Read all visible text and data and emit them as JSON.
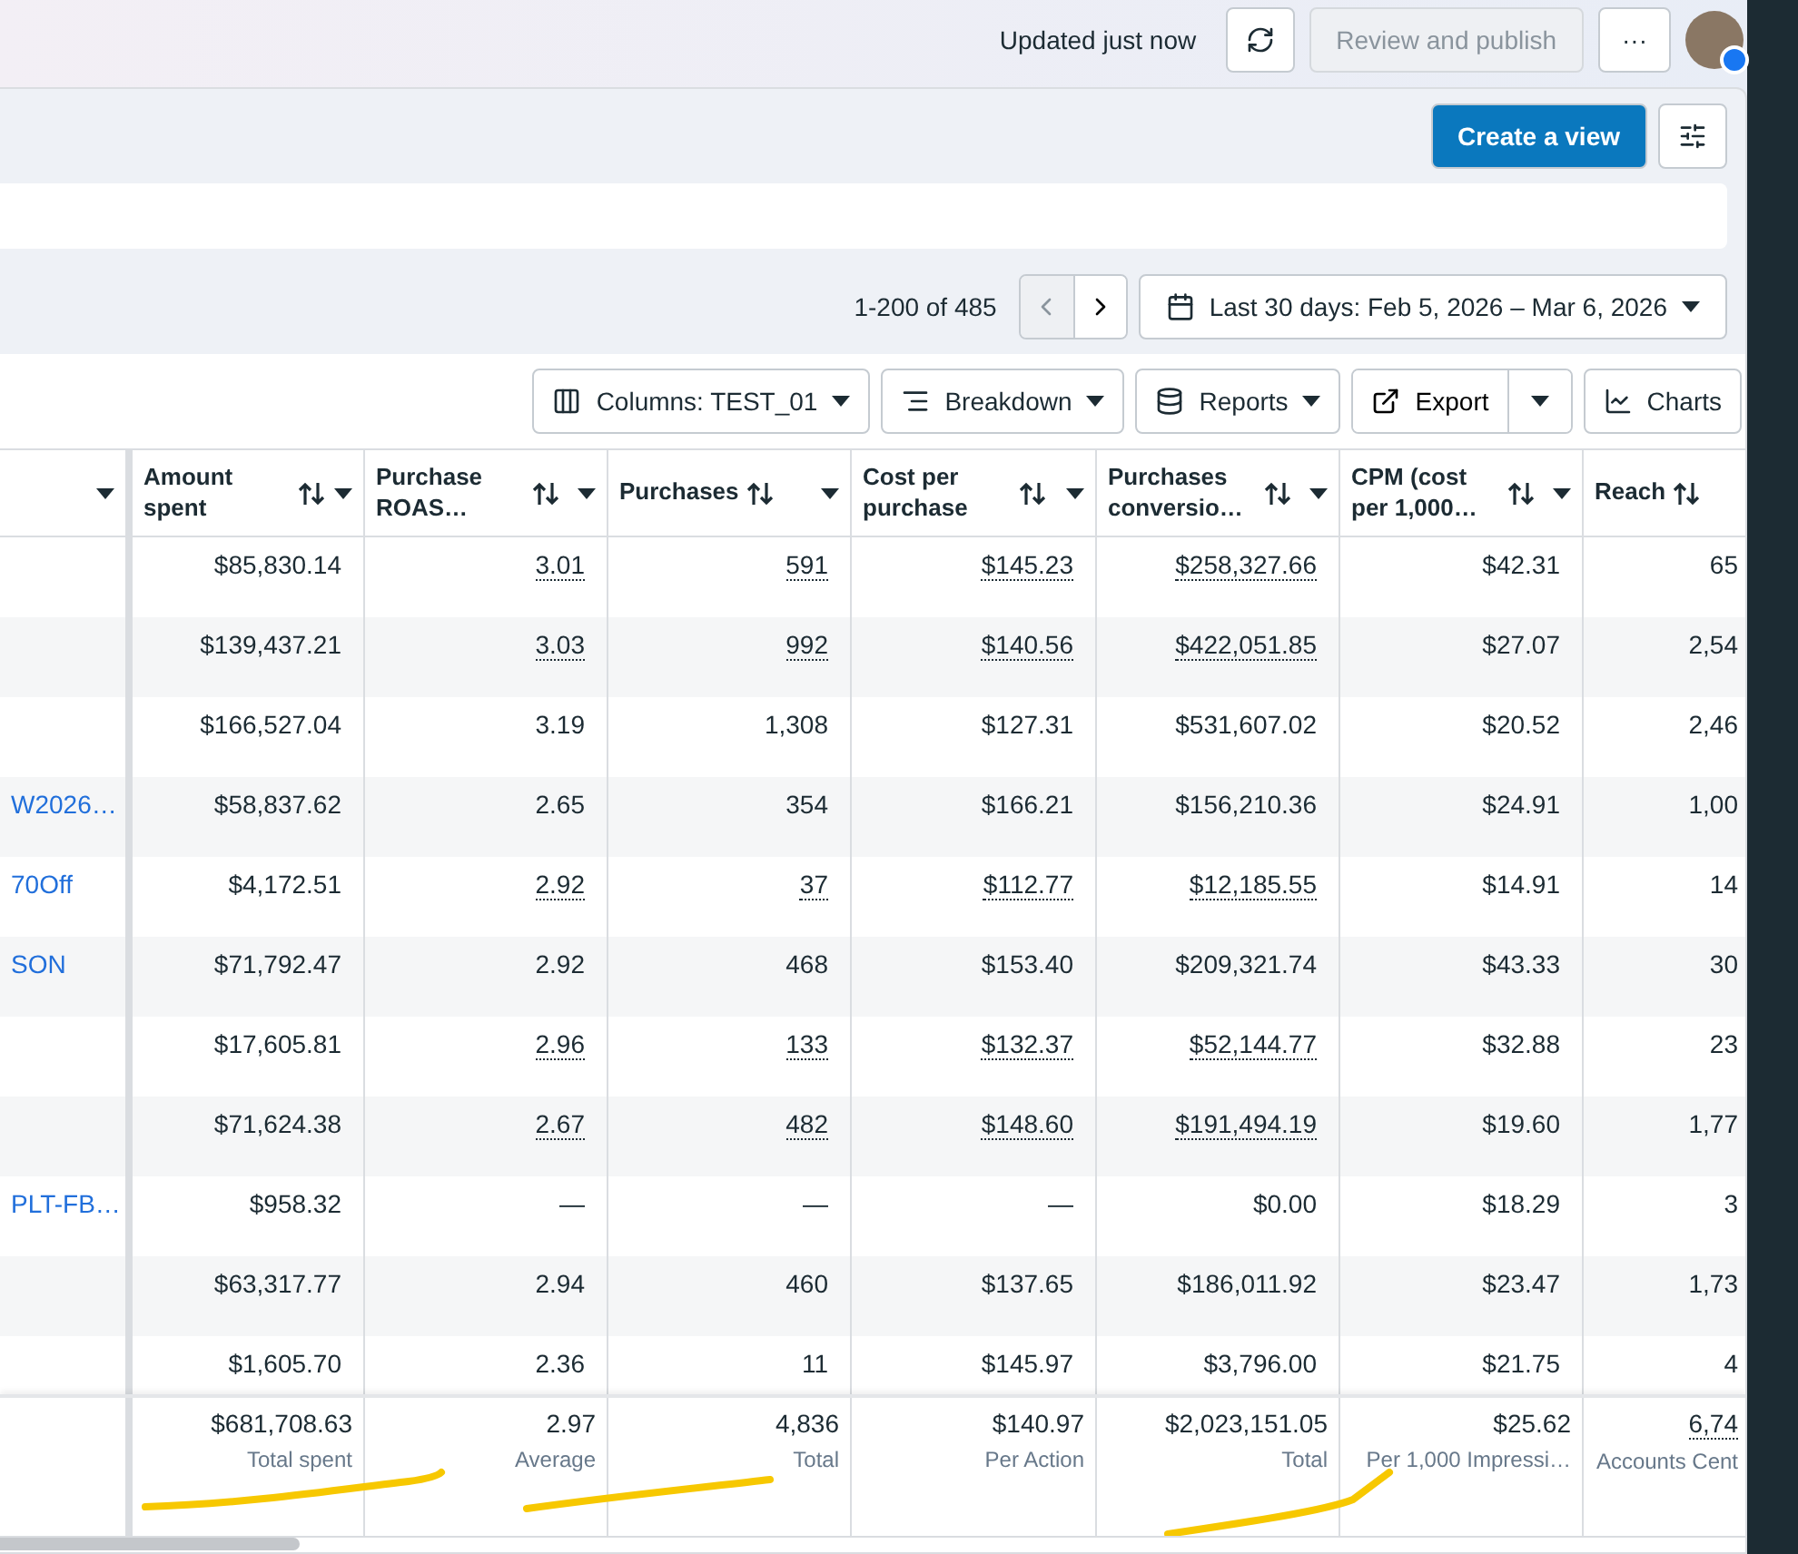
{
  "top_bar": {
    "status": "Updated just now",
    "review_button": {
      "label": "Review and publish",
      "disabled": true
    },
    "more_button": "···"
  },
  "view_bar": {
    "create_button": "Create a view"
  },
  "pagination": {
    "range": "1-200 of 485",
    "date_range": "Last 30 days: Feb 5, 2026 – Mar 6, 2026"
  },
  "toolbar": [
    {
      "kind": "columns",
      "label": "Columns: TEST_01"
    },
    {
      "kind": "breakdown",
      "label": "Breakdown"
    },
    {
      "kind": "reports",
      "label": "Reports"
    },
    {
      "kind": "export",
      "label": "Export"
    },
    {
      "kind": "charts",
      "label": "Charts"
    }
  ],
  "table": {
    "columns": [
      {
        "sortable": false,
        "menu": true
      },
      {
        "label": "Amount spent",
        "sortable": true,
        "menu": true
      },
      {
        "label": "Purchase ROAS…",
        "sortable": true,
        "menu": true
      },
      {
        "label": "Purchases",
        "sortable": true,
        "menu": true
      },
      {
        "label": "Cost per purchase",
        "sortable": true,
        "menu": true
      },
      {
        "label": "Purchases conversio…",
        "sortable": true,
        "menu": true
      },
      {
        "label": "CPM (cost per 1,000…",
        "sortable": true,
        "menu": true
      },
      {
        "label": "Reach",
        "sortable": true,
        "menu": false
      }
    ],
    "rows": [
      {
        "name": "",
        "cells": [
          {
            "text": "$85,830.14",
            "dotted": false
          },
          {
            "text": "3.01",
            "dotted": true
          },
          {
            "text": "591",
            "dotted": true
          },
          {
            "text": "$145.23",
            "dotted": true
          },
          {
            "text": "$258,327.66",
            "dotted": true
          },
          {
            "text": "$42.31",
            "dotted": false
          },
          {
            "text": "65",
            "dotted": false
          }
        ]
      },
      {
        "name": "",
        "cells": [
          {
            "text": "$139,437.21",
            "dotted": false
          },
          {
            "text": "3.03",
            "dotted": true
          },
          {
            "text": "992",
            "dotted": true
          },
          {
            "text": "$140.56",
            "dotted": true
          },
          {
            "text": "$422,051.85",
            "dotted": true
          },
          {
            "text": "$27.07",
            "dotted": false
          },
          {
            "text": "2,54",
            "dotted": false
          }
        ]
      },
      {
        "name": "",
        "cells": [
          {
            "text": "$166,527.04",
            "dotted": false
          },
          {
            "text": "3.19",
            "dotted": false
          },
          {
            "text": "1,308",
            "dotted": false
          },
          {
            "text": "$127.31",
            "dotted": false
          },
          {
            "text": "$531,607.02",
            "dotted": false
          },
          {
            "text": "$20.52",
            "dotted": false
          },
          {
            "text": "2,46",
            "dotted": false
          }
        ]
      },
      {
        "name": "W2026…",
        "cells": [
          {
            "text": "$58,837.62",
            "dotted": false
          },
          {
            "text": "2.65",
            "dotted": false
          },
          {
            "text": "354",
            "dotted": false
          },
          {
            "text": "$166.21",
            "dotted": false
          },
          {
            "text": "$156,210.36",
            "dotted": false
          },
          {
            "text": "$24.91",
            "dotted": false
          },
          {
            "text": "1,00",
            "dotted": false
          }
        ]
      },
      {
        "name": "70Off",
        "cells": [
          {
            "text": "$4,172.51",
            "dotted": false
          },
          {
            "text": "2.92",
            "dotted": true
          },
          {
            "text": "37",
            "dotted": true
          },
          {
            "text": "$112.77",
            "dotted": true
          },
          {
            "text": "$12,185.55",
            "dotted": true
          },
          {
            "text": "$14.91",
            "dotted": false
          },
          {
            "text": "14",
            "dotted": false
          }
        ]
      },
      {
        "name": "SON",
        "cells": [
          {
            "text": "$71,792.47",
            "dotted": false
          },
          {
            "text": "2.92",
            "dotted": false
          },
          {
            "text": "468",
            "dotted": false
          },
          {
            "text": "$153.40",
            "dotted": false
          },
          {
            "text": "$209,321.74",
            "dotted": false
          },
          {
            "text": "$43.33",
            "dotted": false
          },
          {
            "text": "30",
            "dotted": false
          }
        ]
      },
      {
        "name": "",
        "cells": [
          {
            "text": "$17,605.81",
            "dotted": false
          },
          {
            "text": "2.96",
            "dotted": true
          },
          {
            "text": "133",
            "dotted": true
          },
          {
            "text": "$132.37",
            "dotted": true
          },
          {
            "text": "$52,144.77",
            "dotted": true
          },
          {
            "text": "$32.88",
            "dotted": false
          },
          {
            "text": "23",
            "dotted": false
          }
        ]
      },
      {
        "name": "",
        "cells": [
          {
            "text": "$71,624.38",
            "dotted": false
          },
          {
            "text": "2.67",
            "dotted": true
          },
          {
            "text": "482",
            "dotted": true
          },
          {
            "text": "$148.60",
            "dotted": true
          },
          {
            "text": "$191,494.19",
            "dotted": true
          },
          {
            "text": "$19.60",
            "dotted": false
          },
          {
            "text": "1,77",
            "dotted": false
          }
        ]
      },
      {
        "name": "PLT-FB…",
        "cells": [
          {
            "text": "$958.32",
            "dotted": false
          },
          {
            "text": "—",
            "dotted": false
          },
          {
            "text": "—",
            "dotted": false
          },
          {
            "text": "—",
            "dotted": false
          },
          {
            "text": "$0.00",
            "dotted": false
          },
          {
            "text": "$18.29",
            "dotted": false
          },
          {
            "text": "3",
            "dotted": false
          }
        ]
      },
      {
        "name": "",
        "cells": [
          {
            "text": "$63,317.77",
            "dotted": false
          },
          {
            "text": "2.94",
            "dotted": false
          },
          {
            "text": "460",
            "dotted": false
          },
          {
            "text": "$137.65",
            "dotted": false
          },
          {
            "text": "$186,011.92",
            "dotted": false
          },
          {
            "text": "$23.47",
            "dotted": false
          },
          {
            "text": "1,73",
            "dotted": false
          }
        ]
      },
      {
        "name": "",
        "cells": [
          {
            "text": "$1,605.70",
            "dotted": false
          },
          {
            "text": "2.36",
            "dotted": false
          },
          {
            "text": "11",
            "dotted": false
          },
          {
            "text": "$145.97",
            "dotted": false
          },
          {
            "text": "$3,796.00",
            "dotted": false
          },
          {
            "text": "$21.75",
            "dotted": false
          },
          {
            "text": "4",
            "dotted": false
          }
        ]
      }
    ],
    "totals": [
      {
        "value": "$681,708.63",
        "label": "Total spent",
        "dotted": false
      },
      {
        "value": "2.97",
        "label": "Average",
        "dotted": false
      },
      {
        "value": "4,836",
        "label": "Total",
        "dotted": false
      },
      {
        "value": "$140.97",
        "label": "Per Action",
        "dotted": false
      },
      {
        "value": "$2,023,151.05",
        "label": "Total",
        "dotted": false
      },
      {
        "value": "$25.62",
        "label": "Per 1,000 Impressi…",
        "dotted": false
      },
      {
        "value": "6,74",
        "label": "Accounts Cent",
        "dotted": true
      }
    ]
  }
}
